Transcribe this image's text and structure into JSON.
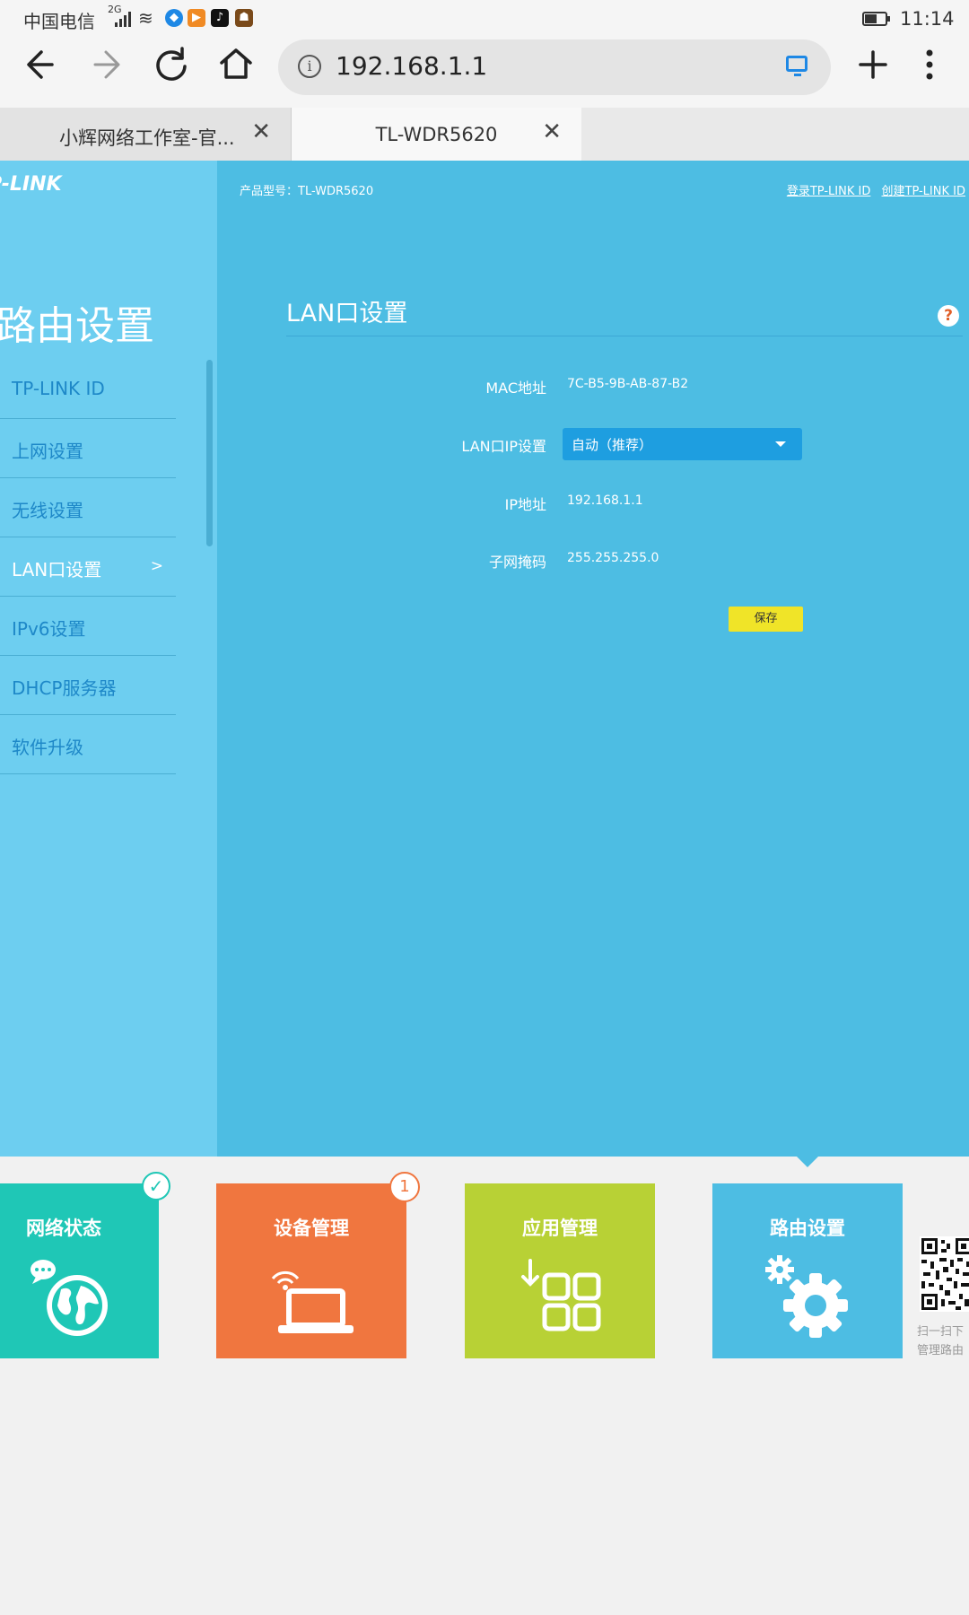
{
  "status_bar": {
    "carrier": "中国电信",
    "network_type": "2G",
    "time": "11:14",
    "battery_level": 0.55,
    "icons": [
      "signal-icon",
      "wifi-icon",
      "browser-app-icon",
      "video-app-icon",
      "tiktok-app-icon",
      "game-app-icon"
    ]
  },
  "browser": {
    "url": "192.168.1.1",
    "tabs": [
      {
        "label": "小辉网络工作室-官...",
        "active": false
      },
      {
        "label": "TL-WDR5620",
        "active": true
      }
    ],
    "icons": {
      "back": "back-arrow-icon",
      "forward": "forward-arrow-icon",
      "reload": "reload-icon",
      "home": "home-icon",
      "info": "info-icon",
      "cast": "cast-icon",
      "new_tab": "plus-icon",
      "menu": "more-vert-icon"
    }
  },
  "router": {
    "logo": "P-LINK",
    "product_model": "产品型号：TL-WDR5620",
    "links": {
      "login": "登录TP-LINK ID",
      "create": "创建TP-LINK ID"
    },
    "sidebar_title": "路由设置",
    "nav": [
      {
        "label": "TP-LINK ID"
      },
      {
        "label": "上网设置"
      },
      {
        "label": "无线设置"
      },
      {
        "label": "LAN口设置",
        "active": true,
        "arrow": ">"
      },
      {
        "label": "IPv6设置"
      },
      {
        "label": "DHCP服务器"
      },
      {
        "label": "软件升级"
      }
    ],
    "section_title": "LAN口设置",
    "help": "?",
    "form": {
      "mac_label": "MAC地址",
      "mac_value": "7C-B5-9B-AB-87-B2",
      "lan_ip_label": "LAN口IP设置",
      "lan_ip_value": "自动（推荐）",
      "ip_label": "IP地址",
      "ip_value": "192.168.1.1",
      "mask_label": "子网掩码",
      "mask_value": "255.255.255.0",
      "save": "保存"
    },
    "tiles": [
      {
        "label": "网络状态",
        "color": "#1fc7b6",
        "icon": "globe-chat-icon"
      },
      {
        "label": "设备管理",
        "color": "#f0763f",
        "icon": "laptop-wifi-icon",
        "badge": "1"
      },
      {
        "label": "应用管理",
        "color": "#b8d135",
        "icon": "app-grid-icon"
      },
      {
        "label": "路由设置",
        "color": "#4dbde3",
        "icon": "gear-icon"
      }
    ],
    "qr_caption": [
      "扫一扫下",
      "管理路由"
    ]
  }
}
